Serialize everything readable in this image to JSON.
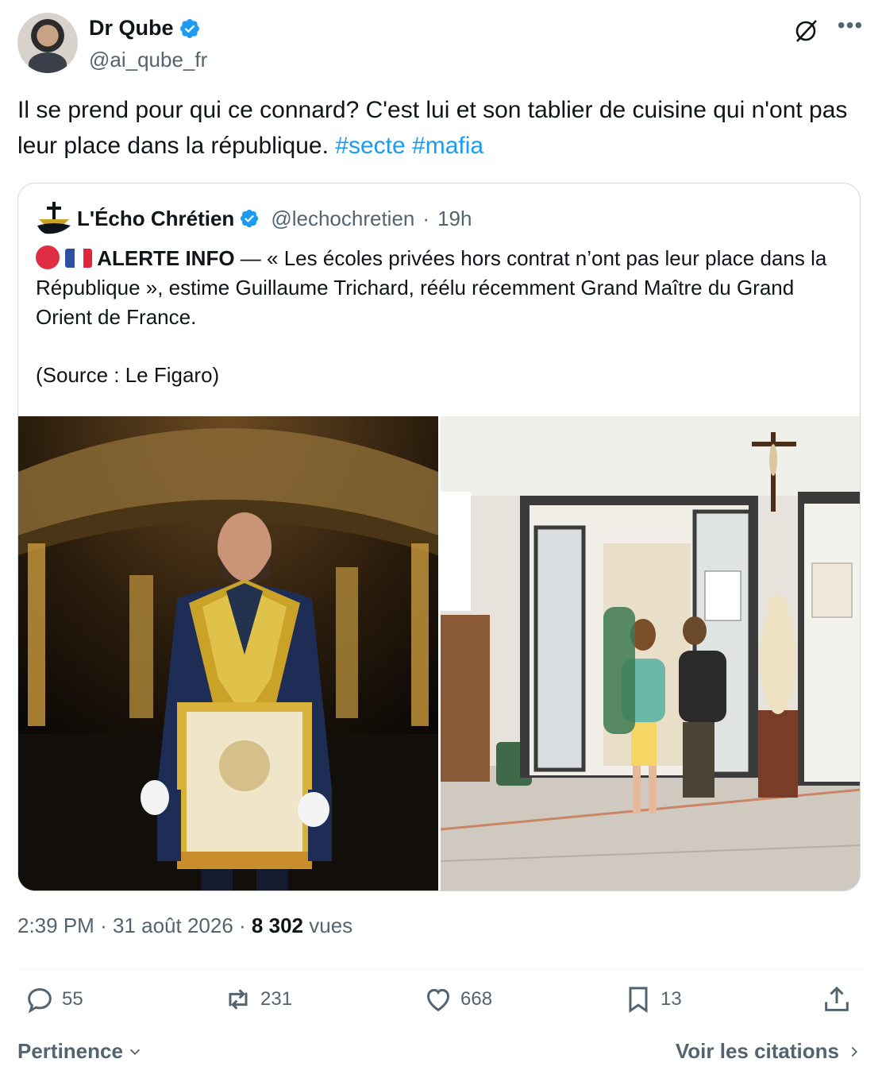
{
  "author": {
    "name": "Dr Qube",
    "handle": "@ai_qube_fr"
  },
  "tweet": {
    "text": "Il se prend pour qui ce connard? C'est lui et son tablier de cuisine qui n'ont pas leur place dans la république.",
    "hashtags": [
      "#secte",
      "#mafia"
    ]
  },
  "quote": {
    "name": "L'Écho Chrétien",
    "handle": "@lechochretien",
    "separator": "·",
    "time": "19h",
    "alert_label": "ALERTE INFO",
    "text": " — « Les écoles privées hors contrat n’ont pas leur place dans la République », estime Guillaume Trichard, réélu récemment Grand Maître du Grand Orient de France.",
    "source": "(Source : Le Figaro)"
  },
  "meta": {
    "time": "2:39 PM",
    "sep1": "·",
    "date": "31 août 2026",
    "sep2": "·",
    "views_count": "8 302",
    "views_label": "vues"
  },
  "actions": {
    "replies": "55",
    "reposts": "231",
    "likes": "668",
    "bookmarks": "13"
  },
  "footer": {
    "sort_label": "Pertinence",
    "quotes_link": "Voir les citations"
  },
  "colors": {
    "accent": "#1d9bf0",
    "text": "#0f1419",
    "muted": "#536471",
    "border": "#cfd9de"
  },
  "icons": [
    "verified-badge-icon",
    "grok-icon",
    "more-icon",
    "reply-icon",
    "repost-icon",
    "like-icon",
    "bookmark-icon",
    "share-icon",
    "chevron-down-icon",
    "chevron-right-icon"
  ]
}
